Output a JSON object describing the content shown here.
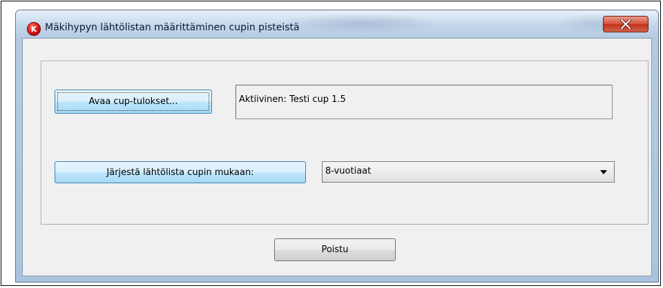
{
  "window": {
    "title": "Mäkihypyn lähtölistan määrittäminen cupin pisteistä",
    "app_icon": "K",
    "icons": {
      "app": "app-logo-icon",
      "close": "close-icon"
    }
  },
  "main": {
    "open_button_label": "Avaa cup-tulokset...",
    "active_cup_text": "Aktiivinen: Testi cup 1.5",
    "sort_button_label": "Järjestä lähtölista cupin mukaan:",
    "category_select": {
      "selected": "8-vuotiaat"
    }
  },
  "footer": {
    "exit_button_label": "Poistu"
  },
  "colors": {
    "close_button": "#c2331b",
    "primary_button": "#bee6fd",
    "client_background": "#f0f0f0"
  }
}
